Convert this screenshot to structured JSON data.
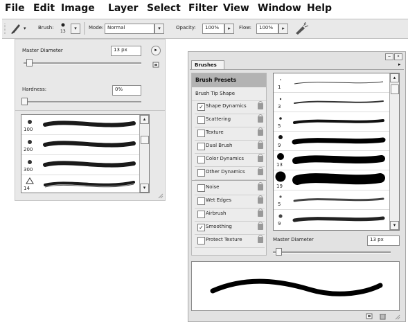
{
  "menubar": {
    "items": [
      "File",
      "Edit",
      "Image",
      "Layer",
      "Select",
      "Filter",
      "View",
      "Window",
      "Help"
    ]
  },
  "options_bar": {
    "brush_label": "Brush:",
    "brush_size": "13",
    "mode_label": "Mode:",
    "mode_value": "Normal",
    "opacity_label": "Opacity:",
    "opacity_value": "100%",
    "flow_label": "Flow:",
    "flow_value": "100%"
  },
  "brush_picker": {
    "master_diameter_label": "Master Diameter",
    "master_diameter_value": "13 px",
    "hardness_label": "Hardness:",
    "hardness_value": "0%",
    "presets": [
      {
        "size": "100"
      },
      {
        "size": "200"
      },
      {
        "size": "300"
      },
      {
        "size": "14"
      }
    ]
  },
  "brushes_panel": {
    "tab_title": "Brushes",
    "categories": [
      {
        "label": "Brush Presets",
        "header": true
      },
      {
        "label": "Brush Tip Shape",
        "checkbox": false
      },
      {
        "label": "Shape Dynamics",
        "checked": true
      },
      {
        "label": "Scattering",
        "checked": false
      },
      {
        "label": "Texture",
        "checked": false
      },
      {
        "label": "Dual Brush",
        "checked": false
      },
      {
        "label": "Color Dynamics",
        "checked": false
      },
      {
        "label": "Other Dynamics",
        "checked": false
      },
      {
        "label": "Noise",
        "checked": false
      },
      {
        "label": "Wet Edges",
        "checked": false
      },
      {
        "label": "Airbrush",
        "checked": false
      },
      {
        "label": "Smoothing",
        "checked": true
      },
      {
        "label": "Protect Texture",
        "checked": false
      }
    ],
    "preset_sizes": [
      "1",
      "3",
      "5",
      "9",
      "13",
      "19",
      "5",
      "9"
    ],
    "master_diameter_label": "Master Diameter",
    "master_diameter_value": "13 px"
  }
}
